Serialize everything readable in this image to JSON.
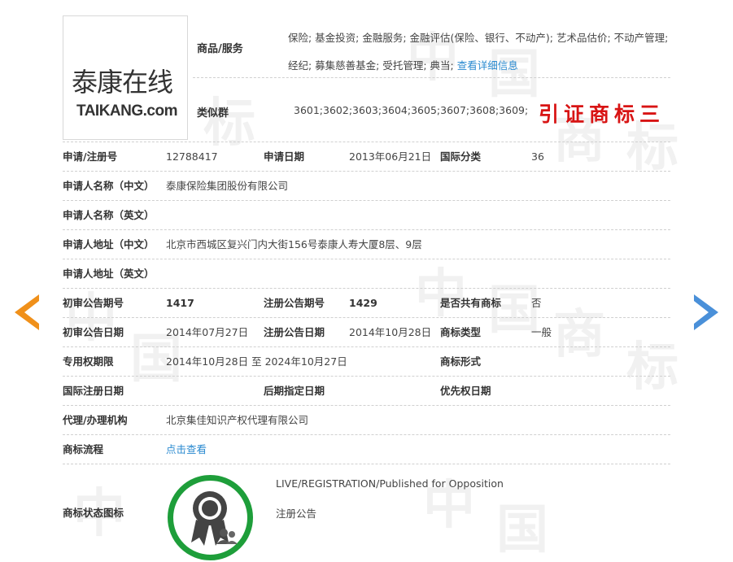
{
  "logo": {
    "cn": "泰康在线",
    "en": "TAIKANG.com"
  },
  "goods": {
    "label": "商品/服务",
    "text": "保险; 基金投资; 金融服务; 金融评估(保险、银行、不动产); 艺术品估价; 不动产管理; 经纪; 募集慈善基金; 受托管理; 典当; ",
    "link": "查看详细信息"
  },
  "similar": {
    "label": "类似群",
    "value": "3601;3602;3603;3604;3605;3607;3608;3609;"
  },
  "annotation": "引证商标三",
  "rows": {
    "reg_no": {
      "label": "申请/注册号",
      "value": "12788417"
    },
    "apply_date": {
      "label": "申请日期",
      "value": "2013年06月21日"
    },
    "intl_class": {
      "label": "国际分类",
      "value": "36"
    },
    "applicant_cn": {
      "label": "申请人名称（中文）",
      "value": "泰康保险集团股份有限公司"
    },
    "applicant_en": {
      "label": "申请人名称（英文）",
      "value": ""
    },
    "address_cn": {
      "label": "申请人地址（中文）",
      "value": "北京市西城区复兴门内大街156号泰康人寿大厦8层、9层"
    },
    "address_en": {
      "label": "申请人地址（英文）",
      "value": ""
    },
    "prelim_no": {
      "label": "初审公告期号",
      "value": "1417"
    },
    "reg_pub_no": {
      "label": "注册公告期号",
      "value": "1429"
    },
    "shared": {
      "label": "是否共有商标",
      "value": "否"
    },
    "prelim_date": {
      "label": "初审公告日期",
      "value": "2014年07月27日"
    },
    "reg_pub_date": {
      "label": "注册公告日期",
      "value": "2014年10月28日"
    },
    "tm_type": {
      "label": "商标类型",
      "value": "一般"
    },
    "exclusive": {
      "label": "专用权期限",
      "value": "2014年10月28日 至 2024年10月27日"
    },
    "tm_form": {
      "label": "商标形式",
      "value": ""
    },
    "intl_reg_date": {
      "label": "国际注册日期",
      "value": ""
    },
    "later_date": {
      "label": "后期指定日期",
      "value": ""
    },
    "priority_date": {
      "label": "优先权日期",
      "value": ""
    },
    "agent": {
      "label": "代理/办理机构",
      "value": "北京集佳知识产权代理有限公司"
    },
    "flow": {
      "label": "商标流程",
      "value": "点击查看"
    }
  },
  "status": {
    "label": "商标状态图标",
    "line1": "LIVE/REGISTRATION/Published for Opposition",
    "line2": "注册公告"
  },
  "colors": {
    "link": "#2a8ad0",
    "annotation": "#d81414",
    "badge_ring": "#1e9e3a",
    "prev_arrow": "#f0901a",
    "next_arrow": "#4a90d9"
  },
  "icons": {
    "prev": "arrow-left-icon",
    "next": "arrow-right-icon",
    "status": "status-badge-icon"
  }
}
